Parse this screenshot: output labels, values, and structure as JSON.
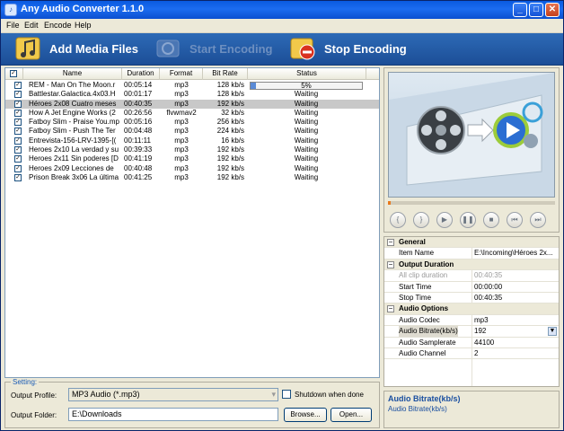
{
  "window": {
    "title": "Any Audio Converter 1.1.0"
  },
  "menu": [
    "File",
    "Edit",
    "Encode",
    "Help"
  ],
  "toolbar": {
    "add": "Add Media Files",
    "start": "Start Encoding",
    "stop": "Stop Encoding"
  },
  "list": {
    "headers": [
      "Name",
      "Duration",
      "Format",
      "Bit Rate",
      "Status"
    ],
    "rows": [
      {
        "name": "REM - Man On The Moon.r",
        "duration": "00:05:14",
        "format": "mp3",
        "bitrate": "128 kb/s",
        "status": "5%",
        "progress": 0.05,
        "selected": false
      },
      {
        "name": "Battlestar.Galactica.4x03.H",
        "duration": "00:01:17",
        "format": "mp3",
        "bitrate": "128 kb/s",
        "status": "Waiting",
        "selected": false
      },
      {
        "name": "Héroes 2x08 Cuatro meses",
        "duration": "00:40:35",
        "format": "mp3",
        "bitrate": "192 kb/s",
        "status": "Waiting",
        "selected": true
      },
      {
        "name": "How A Jet Engine Works (2",
        "duration": "00:26:56",
        "format": "flvwmav2",
        "bitrate": "32 kb/s",
        "status": "Waiting",
        "selected": false
      },
      {
        "name": "Fatboy Slim - Praise You.mp",
        "duration": "00:05:16",
        "format": "mp3",
        "bitrate": "256 kb/s",
        "status": "Waiting",
        "selected": false
      },
      {
        "name": "Fatboy Slim - Push The Ter",
        "duration": "00:04:48",
        "format": "mp3",
        "bitrate": "224 kb/s",
        "status": "Waiting",
        "selected": false
      },
      {
        "name": "Entrevista-156-LRV-1395-[(",
        "duration": "00:11:11",
        "format": "mp3",
        "bitrate": "16 kb/s",
        "status": "Waiting",
        "selected": false
      },
      {
        "name": "Heroes 2x10 La verdad y su",
        "duration": "00:39:33",
        "format": "mp3",
        "bitrate": "192 kb/s",
        "status": "Waiting",
        "selected": false
      },
      {
        "name": "Heroes 2x11 Sin poderes [D",
        "duration": "00:41:19",
        "format": "mp3",
        "bitrate": "192 kb/s",
        "status": "Waiting",
        "selected": false
      },
      {
        "name": "Heroes 2x09 Lecciones de",
        "duration": "00:40:48",
        "format": "mp3",
        "bitrate": "192 kb/s",
        "status": "Waiting",
        "selected": false
      },
      {
        "name": "Prison Break 3x06 La última",
        "duration": "00:41:25",
        "format": "mp3",
        "bitrate": "192 kb/s",
        "status": "Waiting",
        "selected": false
      }
    ]
  },
  "setting": {
    "legend": "Setting:",
    "profile_label": "Output Profile:",
    "profile_value": "MP3 Audio (*.mp3)",
    "shutdown_label": "Shutdown when done",
    "folder_label": "Output Folder:",
    "folder_value": "E:\\Downloads",
    "browse": "Browse...",
    "open": "Open..."
  },
  "props": {
    "general": "General",
    "item_name_k": "Item Name",
    "item_name_v": "E:\\Incoming\\Héroes 2x...",
    "output_duration": "Output Duration",
    "all_clip_k": "All clip duration",
    "all_clip_v": "00:40:35",
    "start_k": "Start Time",
    "start_v": "00:00:00",
    "stop_k": "Stop Time",
    "stop_v": "00:40:35",
    "audio_options": "Audio Options",
    "codec_k": "Audio Codec",
    "codec_v": "mp3",
    "bitrate_k": "Audio Bitrate(kb/s)",
    "bitrate_v": "192",
    "samplerate_k": "Audio Samplerate",
    "samplerate_v": "44100",
    "channel_k": "Audio Channel",
    "channel_v": "2"
  },
  "desc": {
    "title": "Audio Bitrate(kb/s)",
    "text": "Audio Bitrate(kb/s)"
  }
}
